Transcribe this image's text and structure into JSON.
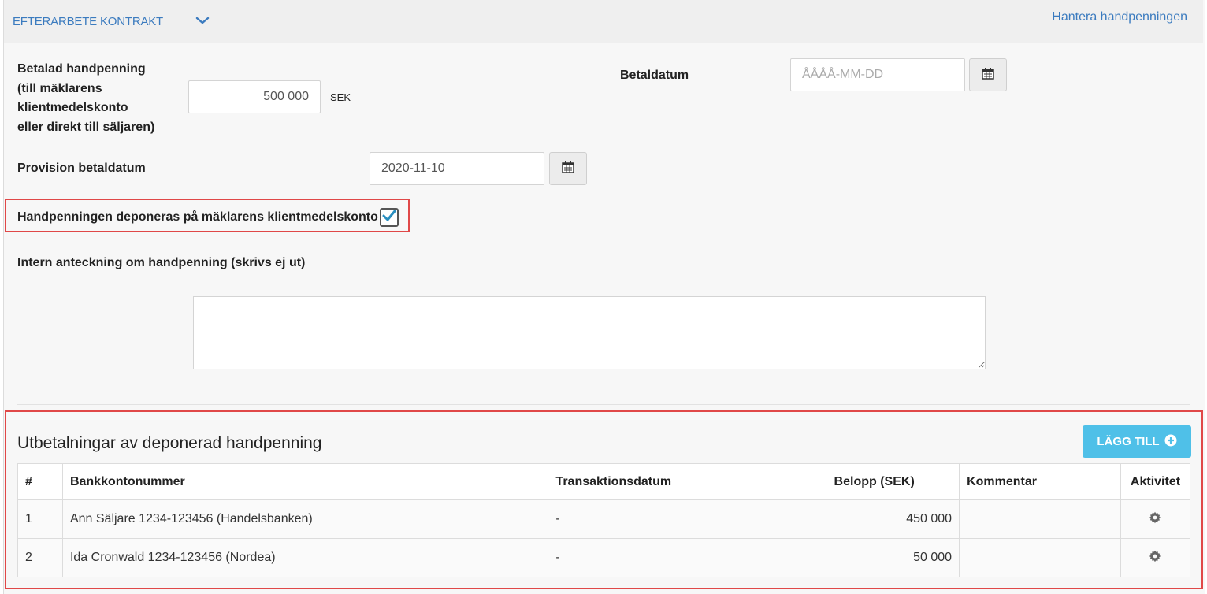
{
  "header": {
    "title": "EFTERARBETE KONTRAKT",
    "manage_link": "Hantera handpenningen"
  },
  "form": {
    "deposit_paid_label": [
      "Betalad handpenning",
      "(till mäklarens",
      "klientmedelskonto",
      "eller direkt till säljaren)"
    ],
    "deposit_amount": "500 000",
    "currency": "SEK",
    "paid_date_label": "Betaldatum",
    "paid_date_placeholder": "ÅÅÅÅ-MM-DD",
    "commission_date_label": "Provision betaldatum",
    "commission_date_value": "2020-11-10",
    "deposit_client_account_label": "Handpenningen deponeras på mäklarens klientmedelskonto",
    "deposit_client_account_checked": true,
    "internal_note_label": "Intern anteckning om handpenning (skrivs ej ut)",
    "internal_note_value": ""
  },
  "payouts": {
    "title": "Utbetalningar av deponerad handpenning",
    "add_button": "LÄGG TILL",
    "columns": [
      "#",
      "Bankkontonummer",
      "Transaktionsdatum",
      "Belopp (SEK)",
      "Kommentar",
      "Aktivitet"
    ],
    "rows": [
      {
        "num": "1",
        "account": "Ann Säljare 1234-123456 (Handelsbanken)",
        "date": "-",
        "amount": "450 000",
        "comment": ""
      },
      {
        "num": "2",
        "account": "Ida Cronwald 1234-123456 (Nordea)",
        "date": "-",
        "amount": "50 000",
        "comment": ""
      }
    ]
  },
  "colors": {
    "link": "#3b7bbf",
    "add_button": "#4fc0e8",
    "highlight": "#e04848",
    "checkbox_check": "#2a8fc0"
  }
}
